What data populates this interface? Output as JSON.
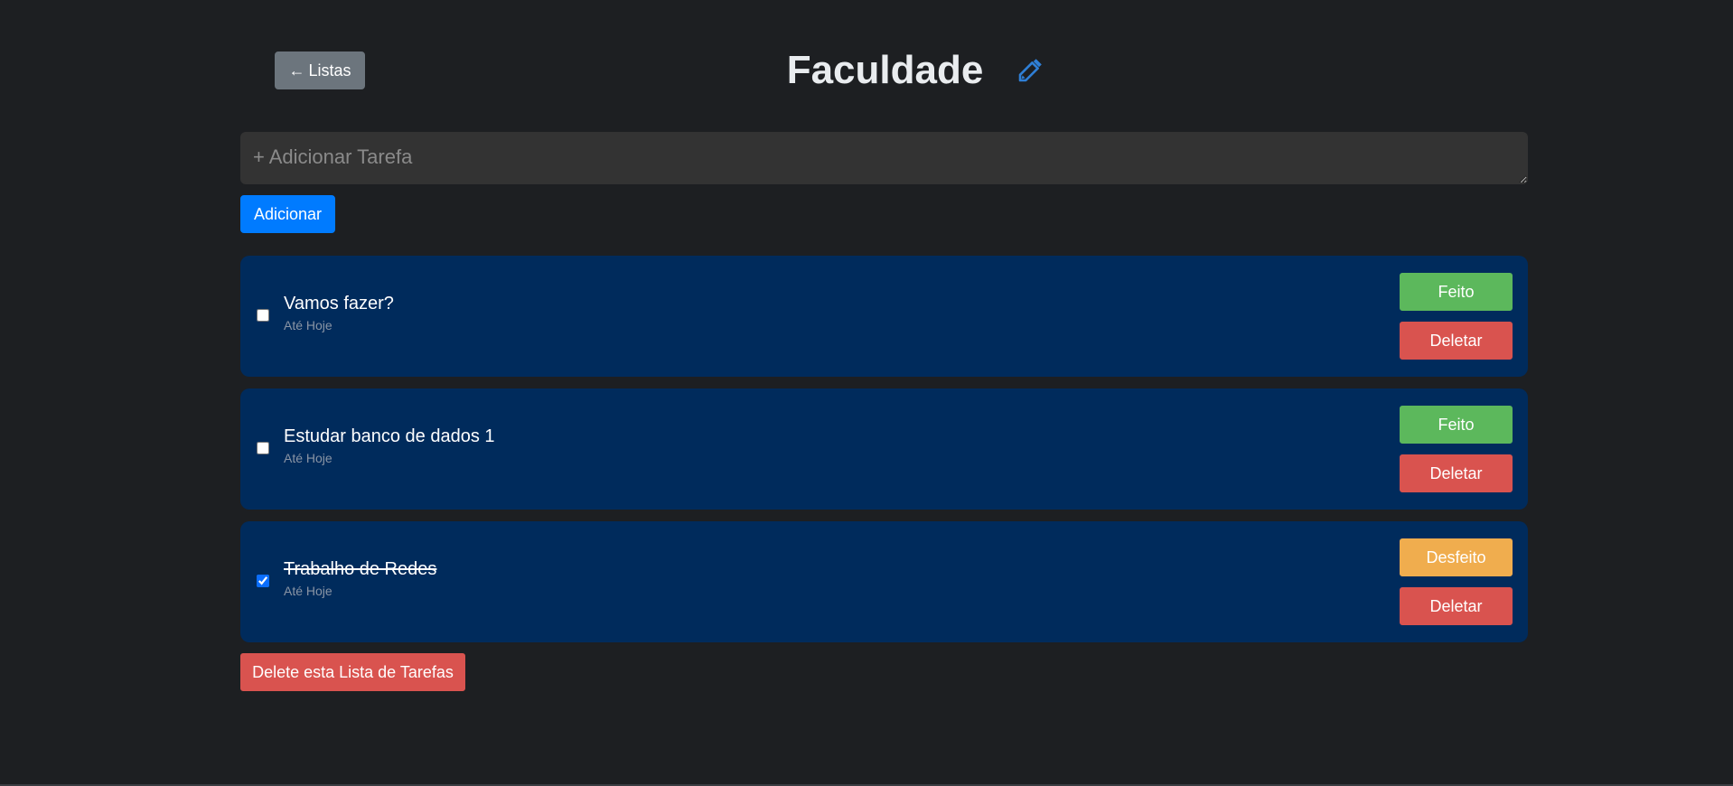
{
  "header": {
    "back_label": "Listas",
    "back_icon": "arrow-left-icon",
    "title": "Faculdade",
    "edit_icon": "pencil-icon",
    "accent_color": "#2f7fd6"
  },
  "new_task": {
    "placeholder": "+ Adicionar Tarefa",
    "value": "",
    "add_label": "Adicionar"
  },
  "tasks": [
    {
      "title": "Vamos fazer?",
      "due": "Até Hoje",
      "checked": false,
      "toggle_label": "Feito",
      "delete_label": "Deletar"
    },
    {
      "title": "Estudar banco de dados 1",
      "due": "Até Hoje",
      "checked": false,
      "toggle_label": "Feito",
      "delete_label": "Deletar"
    },
    {
      "title": "Trabalho de Redes",
      "due": "Até Hoje",
      "checked": true,
      "toggle_label": "Desfeito",
      "delete_label": "Deletar"
    }
  ],
  "footer": {
    "delete_list_label": "Delete esta Lista de Tarefas"
  },
  "colors": {
    "background": "#1d1f22",
    "card": "#002b5c",
    "primary": "#007bff",
    "success": "#5cb85c",
    "warning": "#f0ad4e",
    "danger": "#d9534f",
    "secondary": "#6c757d"
  }
}
